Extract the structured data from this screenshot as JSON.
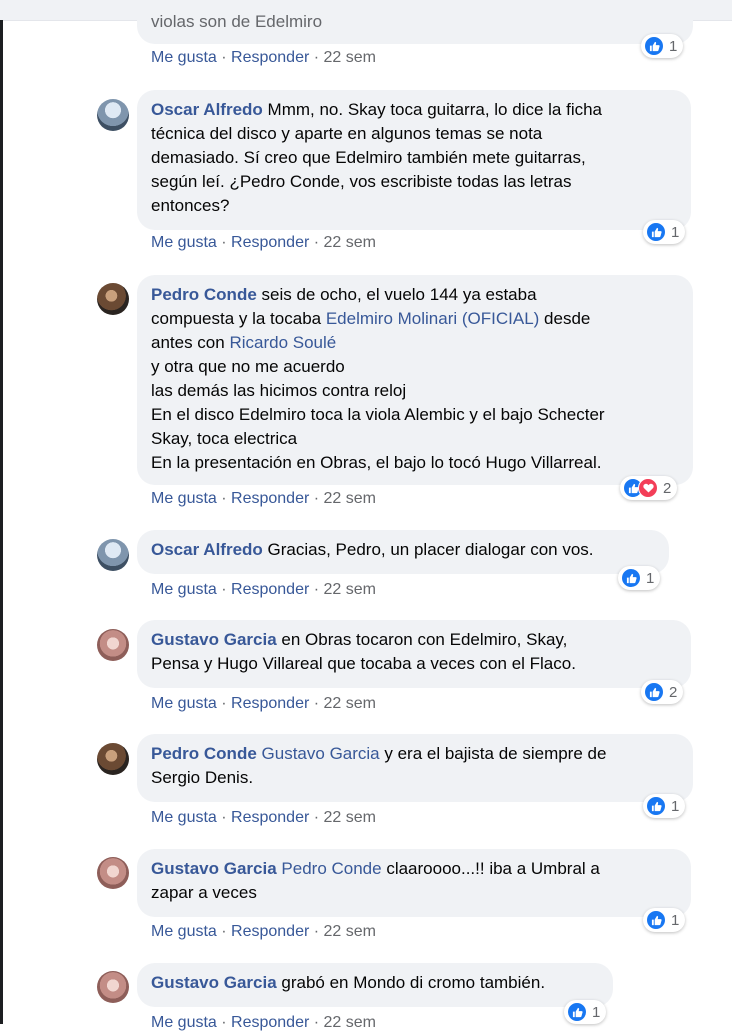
{
  "top_cutoff": "violas son de Edelmiro",
  "actions": {
    "like": "Me gusta",
    "sep": " · ",
    "reply": "Responder",
    "time": "22 sem"
  },
  "c0": {
    "reaction_count": "1"
  },
  "c1": {
    "author": "Oscar Alfredo",
    "lines": [
      "Mmm, no. Skay toca guitarra, lo dice la ficha",
      "técnica del disco y aparte en algunos temas se nota",
      "demasiado. Sí creo que Edelmiro también mete guitarras,",
      "según leí. ¿Pedro Conde, vos escribiste todas las letras",
      "entonces?"
    ],
    "reaction_count": "1"
  },
  "c2": {
    "author": "Pedro Conde",
    "l1": " seis de ocho, el vuelo 144 ya estaba",
    "l2a": "compuesta y la tocaba ",
    "l2_mention": "Edelmiro Molinari (OFICIAL)",
    "l2b": " desde",
    "l3a": "antes con ",
    "l3_mention": "Ricardo Soulé",
    "lines": [
      "y otra que no me acuerdo",
      "las demás las hicimos contra reloj",
      "En el disco Edelmiro toca la viola Alembic y el bajo Schecter",
      "Skay, toca electrica",
      "En la presentación en Obras, el bajo lo tocó Hugo Villarreal."
    ],
    "reaction_count": "2"
  },
  "c3": {
    "author": "Oscar Alfredo",
    "text": " Gracias, Pedro, un placer dialogar con vos.",
    "reaction_count": "1"
  },
  "c4": {
    "author": "Gustavo Garcia",
    "l1": " en Obras tocaron con Edelmiro, Skay,",
    "l2": "Pensa y Hugo Villareal que tocaba a veces con el Flaco.",
    "reaction_count": "2"
  },
  "c5": {
    "author": "Pedro Conde",
    "mention": "Gustavo Garcia",
    "l1": " y era el bajista de siempre de",
    "l2": "Sergio Denis.",
    "reaction_count": "1"
  },
  "c6": {
    "author": "Gustavo Garcia",
    "mention": "Pedro Conde",
    "l1": " claaroooo...!! iba a Umbral a",
    "l2": "zapar a veces",
    "reaction_count": "1"
  },
  "c7": {
    "author": "Gustavo Garcia",
    "text": " grabó en Mondo di cromo también.",
    "reaction_count": "1"
  }
}
